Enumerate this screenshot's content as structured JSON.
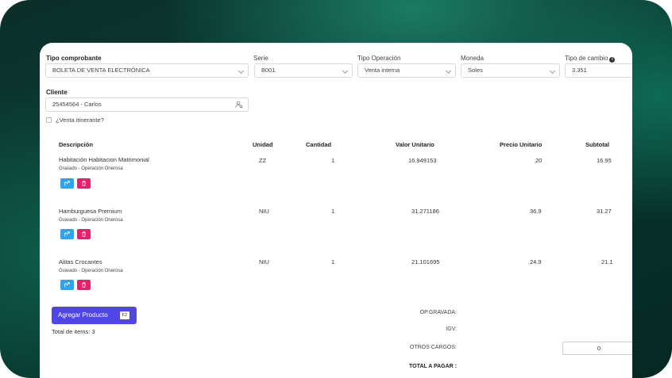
{
  "form": {
    "tipo_comprobante": {
      "label": "Tipo comprobante",
      "value": "BOLETA DE VENTA ELECTRÓNICA"
    },
    "serie": {
      "label": "Serie",
      "value": "B001"
    },
    "tipo_operacion": {
      "label": "Tipo Operación",
      "value": "Venta interna"
    },
    "moneda": {
      "label": "Moneda",
      "value": "Soles"
    },
    "tipo_cambio": {
      "label": "Tipo de cambio",
      "value": "3.351"
    },
    "cliente": {
      "label": "Cliente",
      "value": "25454564 - Carlos"
    },
    "venta_itinerante": {
      "label": "¿Venta itinerante?",
      "checked": false
    }
  },
  "table": {
    "headers": {
      "descripcion": "Descripción",
      "unidad": "Unidad",
      "cantidad": "Cantidad",
      "valor_unitario": "Valor Unitario",
      "precio_unitario": "Precio Unitario",
      "subtotal": "Subtotal"
    },
    "rows": [
      {
        "descripcion": "Habitación Habitacion Matrimonial",
        "afectacion": "Gravado - Operación Onerosa",
        "unidad": "ZZ",
        "cantidad": "1",
        "valor_unitario": "16.949153",
        "precio_unitario": "20",
        "subtotal": "16.95"
      },
      {
        "descripcion": "Hamburguesa Premium",
        "afectacion": "Gravado - Operación Onerosa",
        "unidad": "NIU",
        "cantidad": "1",
        "valor_unitario": "31.271186",
        "precio_unitario": "36.9",
        "subtotal": "31.27"
      },
      {
        "descripcion": "Alitas Crocantes",
        "afectacion": "Gravado - Operación Onerosa",
        "unidad": "NIU",
        "cantidad": "1",
        "valor_unitario": "21.101695",
        "precio_unitario": "24.9",
        "subtotal": "21.1"
      }
    ]
  },
  "actions": {
    "add_product_label": "Agregar Producto",
    "add_product_shortcut": "F2",
    "total_items": "Total de items: 3"
  },
  "totals": {
    "op_gravada_label": "OP.GRAVADA:",
    "igv_label": "IGV:",
    "otros_cargos_label": "OTROS CARGOS:",
    "otros_cargos_value": "0",
    "total_pagar_label": "TOTAL A PAGAR :"
  },
  "colors": {
    "primary_button": "#4f46e5",
    "edit_button": "#2fa3ee",
    "delete_button": "#ee1f6a",
    "background": "#0b3d33"
  },
  "icons": {
    "select": "chevron-down-icon",
    "cliente": "user-search-icon",
    "info": "info-icon",
    "edit": "edit-icon",
    "delete": "trash-icon"
  }
}
